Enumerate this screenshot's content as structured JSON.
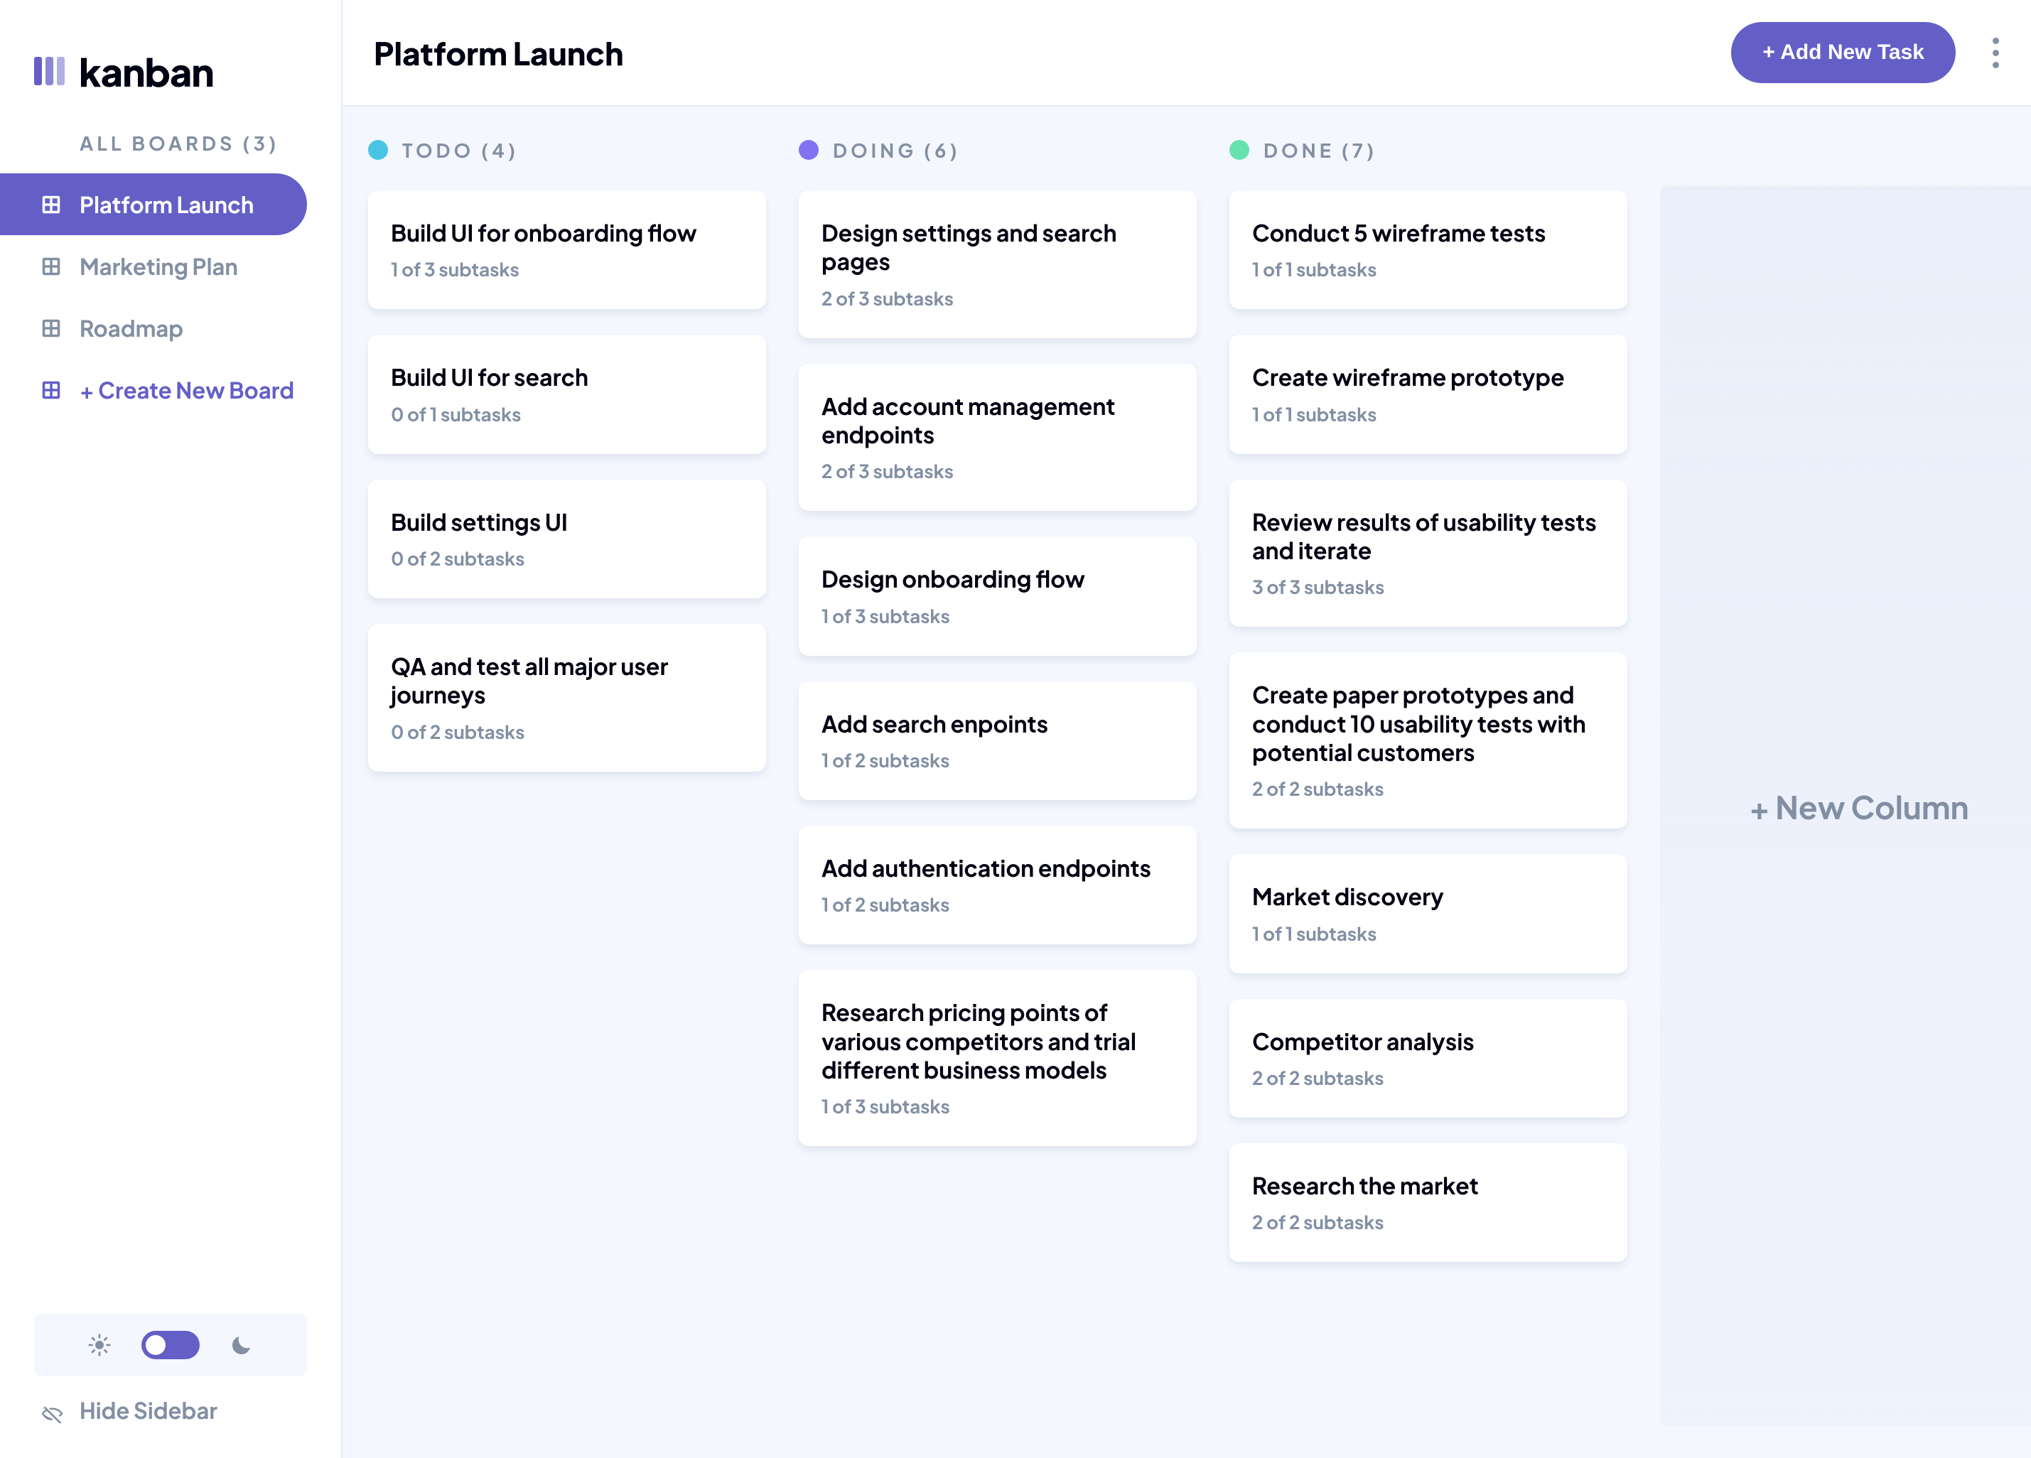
{
  "app": {
    "name": "kanban"
  },
  "sidebar": {
    "all_boards_label": "ALL BOARDS (3)",
    "boards": [
      {
        "label": "Platform Launch",
        "active": true
      },
      {
        "label": "Marketing Plan",
        "active": false
      },
      {
        "label": "Roadmap",
        "active": false
      }
    ],
    "create_label": "+ Create New Board",
    "hide_label": "Hide Sidebar"
  },
  "header": {
    "board_title": "Platform Launch",
    "add_task_label": "+ Add New Task"
  },
  "columns": [
    {
      "name": "TODO (4)",
      "color": "#49C4E5",
      "tasks": [
        {
          "title": "Build UI for onboarding flow",
          "sub": "1 of 3 subtasks"
        },
        {
          "title": "Build UI for search",
          "sub": "0 of 1 subtasks"
        },
        {
          "title": "Build settings UI",
          "sub": "0 of 2 subtasks"
        },
        {
          "title": "QA and test all major user journeys",
          "sub": "0 of 2 subtasks"
        }
      ]
    },
    {
      "name": "DOING (6)",
      "color": "#8471F2",
      "tasks": [
        {
          "title": "Design settings and search pages",
          "sub": "2 of 3 subtasks"
        },
        {
          "title": "Add account management endpoints",
          "sub": "2 of 3 subtasks"
        },
        {
          "title": "Design onboarding flow",
          "sub": "1 of 3 subtasks"
        },
        {
          "title": "Add search enpoints",
          "sub": "1 of 2 subtasks"
        },
        {
          "title": "Add authentication endpoints",
          "sub": "1 of 2 subtasks"
        },
        {
          "title": "Research pricing points of various competitors and trial different business models",
          "sub": "1 of 3 subtasks"
        }
      ]
    },
    {
      "name": "DONE (7)",
      "color": "#67E2AE",
      "tasks": [
        {
          "title": "Conduct 5 wireframe tests",
          "sub": "1 of 1 subtasks"
        },
        {
          "title": "Create wireframe prototype",
          "sub": "1 of 1 subtasks"
        },
        {
          "title": "Review results of usability tests and iterate",
          "sub": "3 of 3 subtasks"
        },
        {
          "title": "Create paper prototypes and conduct 10 usability tests with potential customers",
          "sub": "2 of 2 subtasks"
        },
        {
          "title": "Market discovery",
          "sub": "1 of 1 subtasks"
        },
        {
          "title": "Competitor analysis",
          "sub": "2 of 2 subtasks"
        },
        {
          "title": "Research the market",
          "sub": "2 of 2 subtasks"
        }
      ]
    }
  ],
  "new_column_label": "+ New Column"
}
